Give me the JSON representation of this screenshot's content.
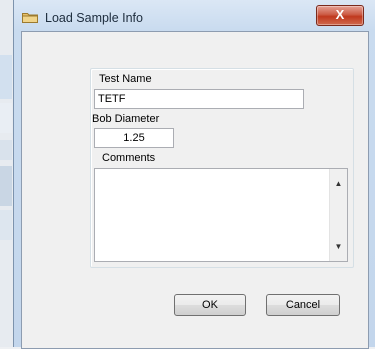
{
  "window": {
    "title": "Load Sample Info",
    "close_glyph": "X"
  },
  "form": {
    "test_name_label": "Test Name",
    "test_name_value": "TETF",
    "bob_diameter_label": "Bob Diameter",
    "bob_diameter_value": "1.25",
    "comments_label": "Comments",
    "comments_value": ""
  },
  "buttons": {
    "ok_label": "OK",
    "cancel_label": "Cancel"
  },
  "icons": {
    "title": "folder-icon",
    "close": "close-icon",
    "scroll_up": "scroll-up-arrow-icon",
    "scroll_down": "scroll-down-arrow-icon"
  },
  "colors": {
    "close_button": "#c9452b",
    "title_bar": "#c9dbef",
    "client_background": "#f0f0f0"
  }
}
